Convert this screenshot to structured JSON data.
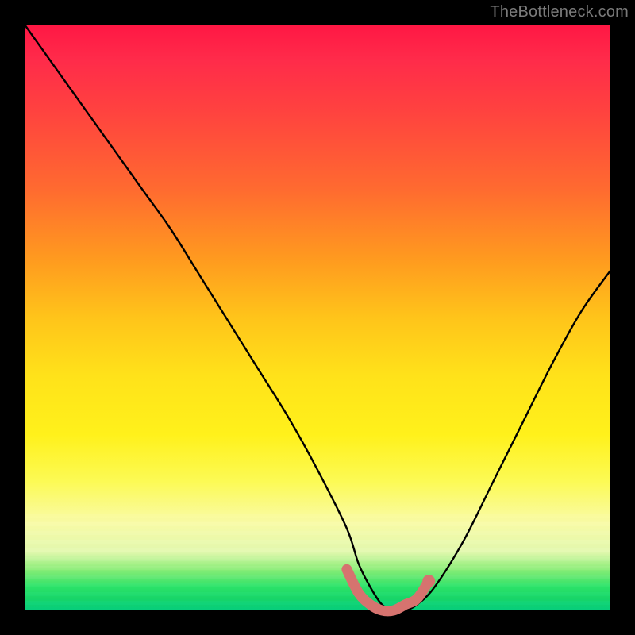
{
  "watermark": "TheBottleneck.com",
  "chart_data": {
    "type": "line",
    "title": "",
    "xlabel": "",
    "ylabel": "",
    "xlim": [
      0,
      100
    ],
    "ylim": [
      0,
      100
    ],
    "series": [
      {
        "name": "bottleneck-curve",
        "x": [
          0,
          5,
          10,
          15,
          20,
          25,
          30,
          35,
          40,
          45,
          50,
          55,
          57,
          59,
          61,
          63,
          65,
          67,
          70,
          75,
          80,
          85,
          90,
          95,
          100
        ],
        "y": [
          100,
          93,
          86,
          79,
          72,
          65,
          57,
          49,
          41,
          33,
          24,
          14,
          8,
          4,
          1,
          0,
          0,
          1,
          4,
          12,
          22,
          32,
          42,
          51,
          58
        ]
      }
    ],
    "highlight": {
      "name": "optimal-region",
      "x": [
        55,
        57,
        59,
        61,
        63,
        65,
        67,
        69
      ],
      "y": [
        7,
        3,
        1,
        0,
        0,
        1,
        2,
        5
      ],
      "end_marker": {
        "x": 69,
        "y": 5
      }
    },
    "colors": {
      "curve": "#000000",
      "highlight": "#d6736f",
      "marker": "#d6736f"
    }
  }
}
